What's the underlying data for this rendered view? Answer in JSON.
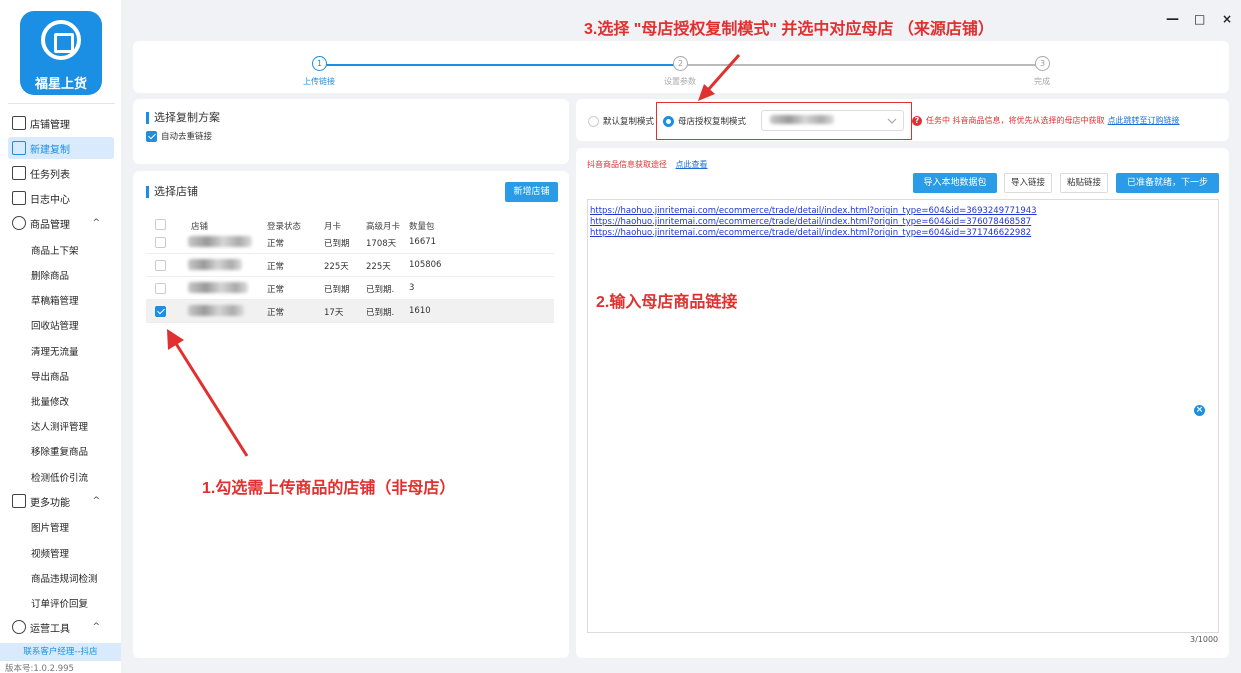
{
  "app": {
    "logo_text": "福星上货",
    "version": "版本号:1.0.2.995",
    "contact": "联系客户经理--抖店"
  },
  "nav": {
    "items": [
      {
        "label": "店铺管理",
        "icon": "store-icon"
      },
      {
        "label": "新建复制",
        "icon": "new-copy-icon",
        "active": true
      },
      {
        "label": "任务列表",
        "icon": "task-list-icon"
      },
      {
        "label": "日志中心",
        "icon": "log-icon"
      },
      {
        "label": "商品管理",
        "icon": "product-box-icon",
        "expand": "^"
      }
    ],
    "product_sub": [
      "商品上下架",
      "删除商品",
      "草稿箱管理",
      "回收站管理",
      "清理无流量",
      "导出商品",
      "批量修改",
      "达人测评管理",
      "移除重复商品",
      "检测低价引流"
    ],
    "more": {
      "label": "更多功能",
      "icon": "grid-icon",
      "expand": "^"
    },
    "more_sub": [
      "图片管理",
      "视频管理",
      "商品违规词检测",
      "订单评价回复"
    ],
    "ops": {
      "label": "运营工具",
      "icon": "ops-tool-icon",
      "expand": "^"
    }
  },
  "window": {
    "minimize": "—",
    "maximize": "□",
    "close": "×"
  },
  "steps": [
    {
      "num": "1",
      "label": "上传链接",
      "active": true
    },
    {
      "num": "2",
      "label": "设置参数",
      "active": false
    },
    {
      "num": "3",
      "label": "完成",
      "active": false
    }
  ],
  "copy_plan": {
    "title": "选择复制方案",
    "dedupe_label": "自动去重链接",
    "dedupe_checked": true
  },
  "stores": {
    "title": "选择店铺",
    "new_button": "新增店铺",
    "columns": [
      "店铺",
      "登录状态",
      "月卡",
      "高级月卡",
      "数量包"
    ],
    "rows": [
      {
        "status": "正常",
        "monthly": "已到期",
        "advanced": "1708天",
        "pack": "16671",
        "checked": false
      },
      {
        "status": "正常",
        "monthly": "225天",
        "advanced": "225天",
        "pack": "105806",
        "checked": false
      },
      {
        "status": "正常",
        "monthly": "已到期",
        "advanced": "已到期.",
        "pack": "3",
        "checked": false
      },
      {
        "status": "正常",
        "monthly": "17天",
        "advanced": "已到期.",
        "pack": "1610",
        "checked": true
      }
    ]
  },
  "mode": {
    "default_label": "默认复制模式",
    "parent_label": "母店授权复制模式",
    "selected": "parent",
    "hint": "任务中 抖音商品信息，将优先从选择的母店中获取",
    "hint_link": "点此跳转至订购链接"
  },
  "links_panel": {
    "source_label": "抖音商品信息获取途径",
    "source_link": "点此查看",
    "btn_import_local": "导入本地数据包",
    "btn_import_link": "导入链接",
    "btn_paste_link": "粘贴链接",
    "btn_next": "已准备就绪，下一步",
    "links": [
      "https://haohuo.jinritemai.com/ecommerce/trade/detail/index.html?origin_type=604&id=3693249771943",
      "https://haohuo.jinritemai.com/ecommerce/trade/detail/index.html?origin_type=604&id=376078468587",
      "https://haohuo.jinritemai.com/ecommerce/trade/detail/index.html?origin_type=604&id=371746622982"
    ],
    "count": "3/1000"
  },
  "annotations": {
    "step1": "1.勾选需上传商品的店铺（非母店）",
    "step2": "2.输入母店商品链接",
    "step3": "3.选择 \"母店授权复制模式\" 并选中对应母店 （来源店铺）"
  }
}
